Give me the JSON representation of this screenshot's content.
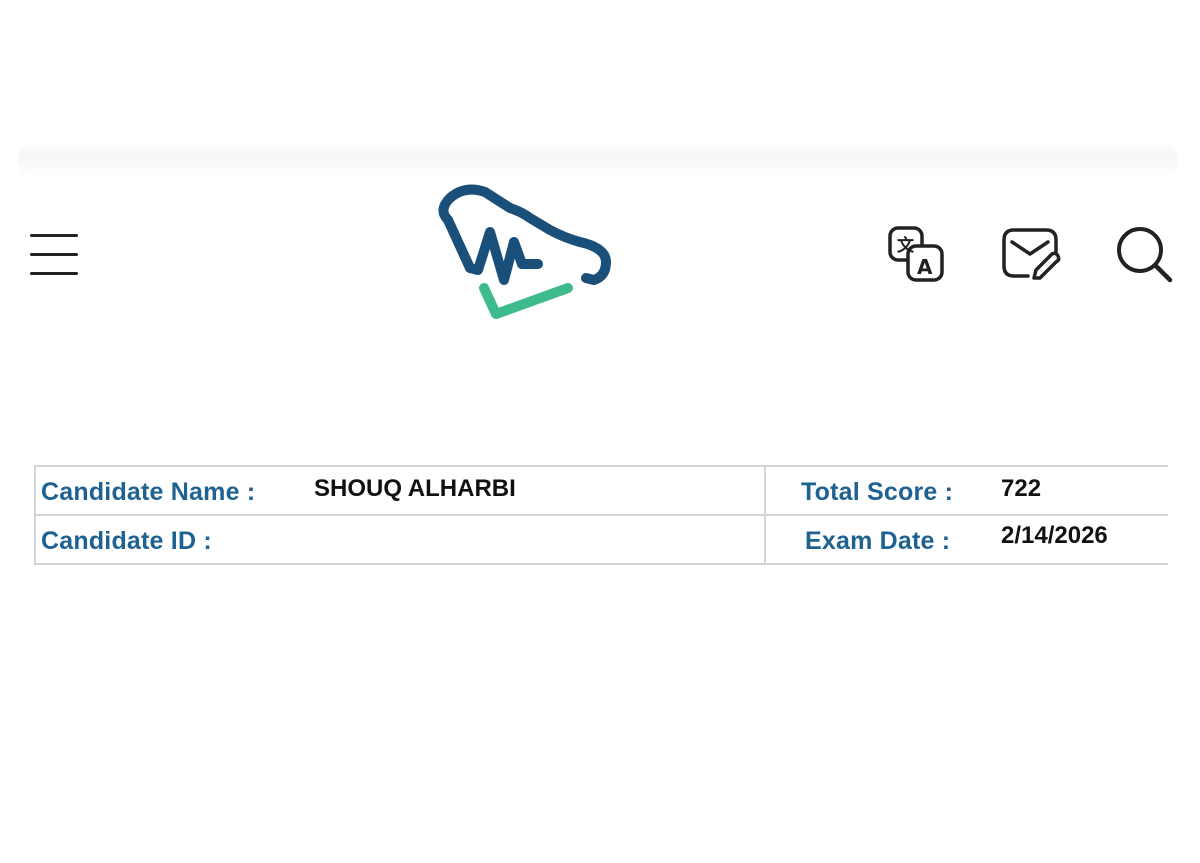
{
  "header": {
    "menu_icon": "hamburger-menu-icon",
    "logo_icon": "health-map-check-logo",
    "actions": [
      {
        "name": "translate-button",
        "icon": "translate-icon"
      },
      {
        "name": "message-button",
        "icon": "message-edit-icon"
      },
      {
        "name": "search-button",
        "icon": "search-icon"
      }
    ],
    "colors": {
      "logo_primary": "#1a4f7a",
      "logo_accent": "#3dbb8c"
    }
  },
  "candidate_info": {
    "name_label": "Candidate Name :",
    "name_value": "SHOUQ ALHARBI",
    "id_label": "Candidate ID :",
    "id_value": "",
    "score_label": "Total Score :",
    "score_value": "722",
    "date_label": "Exam Date :",
    "date_value": "2/14/2026",
    "label_color": "#1e6292"
  }
}
